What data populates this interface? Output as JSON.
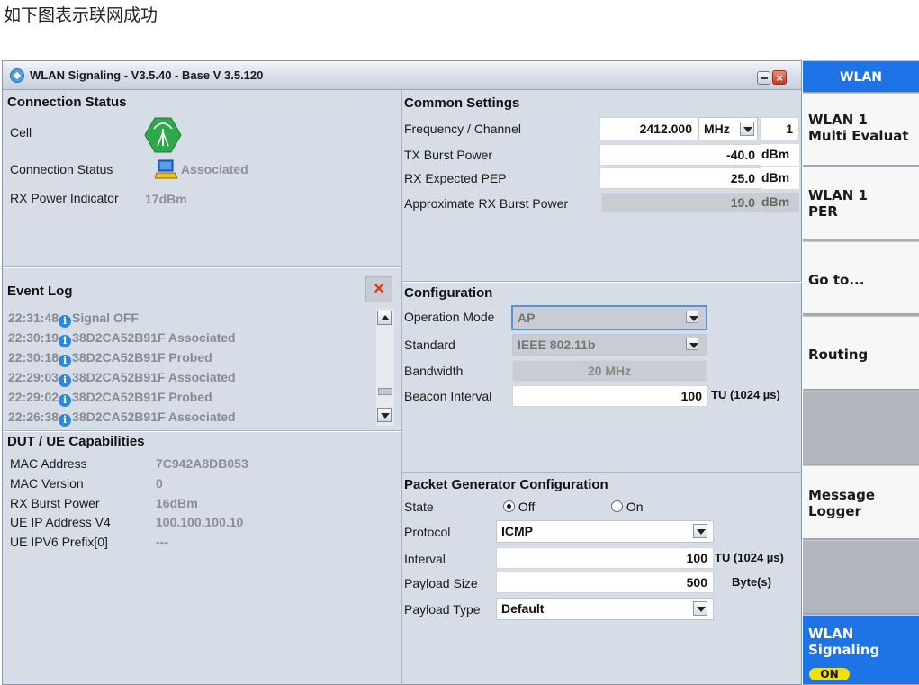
{
  "caption": "如下图表示联网成功",
  "window": {
    "title": "WLAN Signaling  - V3.5.40 - Base V 3.5.120"
  },
  "connection_status": {
    "title": "Connection Status",
    "cell_label": "Cell",
    "connection_label": "Connection Status",
    "connection_value": "Associated",
    "rx_power_label": "RX Power Indicator",
    "rx_power_value": "17dBm"
  },
  "event_log": {
    "title": "Event Log",
    "clear_icon": "×",
    "entries": [
      {
        "time": "22:31:48",
        "text": "Signal OFF"
      },
      {
        "time": "22:30:19",
        "text": "38D2CA52B91F Associated"
      },
      {
        "time": "22:30:18",
        "text": "38D2CA52B91F Probed"
      },
      {
        "time": "22:29:03",
        "text": "38D2CA52B91F Associated"
      },
      {
        "time": "22:29:02",
        "text": "38D2CA52B91F Probed"
      },
      {
        "time": "22:26:38",
        "text": "38D2CA52B91F Associated"
      }
    ]
  },
  "dut_caps": {
    "title": "DUT / UE Capabilities",
    "rows": [
      {
        "label": "MAC Address",
        "value": "7C942A8DB053"
      },
      {
        "label": "MAC Version",
        "value": "0"
      },
      {
        "label": "RX Burst Power",
        "value": "16dBm"
      },
      {
        "label": "UE IP Address V4",
        "value": "100.100.100.10"
      },
      {
        "label": "UE IPV6 Prefix[0]",
        "value": "---"
      }
    ]
  },
  "common_settings": {
    "title": "Common Settings",
    "freq_label": "Frequency / Channel",
    "freq_value": "2412.000",
    "freq_unit": "MHz",
    "channel_value": "1",
    "tx_label": "TX Burst Power",
    "tx_value": "-40.0",
    "tx_unit": "dBm",
    "rx_label": "RX Expected PEP",
    "rx_value": "25.0",
    "rx_unit": "dBm",
    "approx_label": "Approximate RX Burst Power",
    "approx_value": "19.0",
    "approx_unit": "dBm"
  },
  "configuration": {
    "title": "Configuration",
    "opmode_label": "Operation Mode",
    "opmode_value": "AP",
    "standard_label": "Standard",
    "standard_value": "IEEE 802.11b",
    "bandwidth_label": "Bandwidth",
    "bandwidth_value": "20 MHz",
    "beacon_label": "Beacon Interval",
    "beacon_value": "100",
    "beacon_unit": "TU  (1024 µs)"
  },
  "packet_gen": {
    "title": "Packet Generator Configuration",
    "state_label": "State",
    "state_off": "Off",
    "state_on": "On",
    "state_selected": "Off",
    "protocol_label": "Protocol",
    "protocol_value": "ICMP",
    "interval_label": "Interval",
    "interval_value": "100",
    "interval_unit": "TU  (1024 µs)",
    "payload_size_label": "Payload Size",
    "payload_size_value": "500",
    "payload_size_unit": "Byte(s)",
    "payload_type_label": "Payload Type",
    "payload_type_value": "Default"
  },
  "softkeys": {
    "header": "WLAN",
    "k1": "WLAN 1\nMulti Evaluat",
    "k2": "WLAN 1\nPER",
    "k3": "Go to...",
    "k4": "Routing",
    "k5": "Message\nLogger",
    "k6": "WLAN\nSignaling",
    "k6_badge": "ON"
  },
  "colors": {
    "accent_blue": "#1e73e6",
    "badge_yellow": "#f2e000",
    "cell_green": "#2da84a"
  }
}
